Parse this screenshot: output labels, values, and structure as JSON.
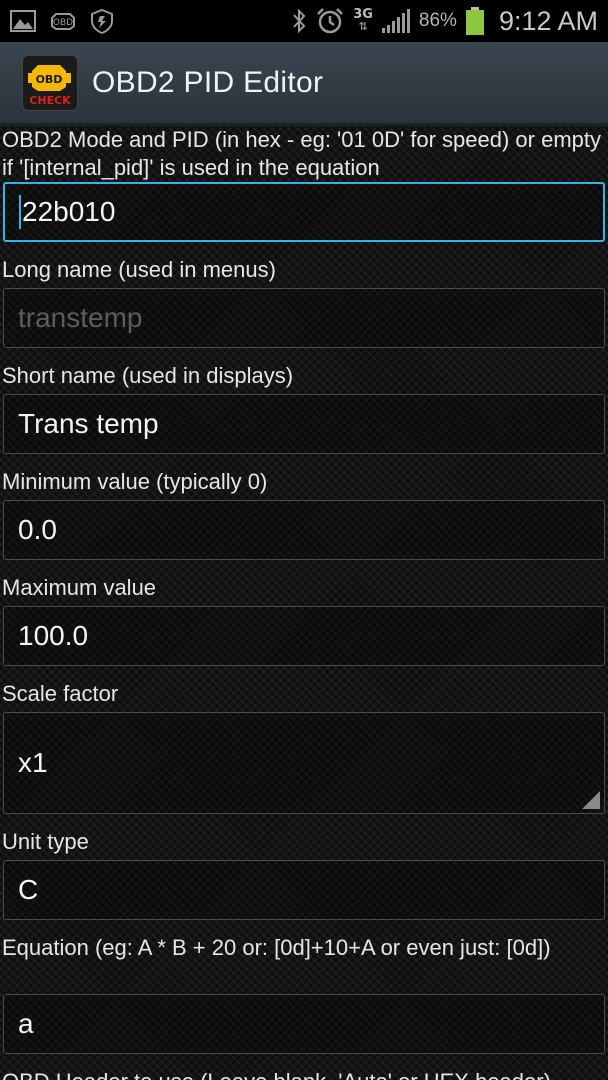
{
  "status_bar": {
    "battery_percent": "86%",
    "clock": "9:12 AM",
    "network": "3G",
    "icons": [
      "gallery-icon",
      "obd-icon",
      "shield-icon",
      "bluetooth-icon",
      "alarm-icon",
      "network-3g-icon",
      "signal-icon",
      "battery-icon"
    ]
  },
  "app_bar": {
    "title": "OBD2 PID Editor",
    "icon_text_top": "OBD",
    "icon_text_bottom": "CHECK"
  },
  "fields": {
    "mode_pid": {
      "label": "OBD2 Mode and PID (in hex - eg: '01 0D' for speed) or empty if '[internal_pid]' is used in the equation",
      "value": "22b010"
    },
    "long_name": {
      "label": "Long name (used in menus)",
      "value": "transtemp"
    },
    "short_name": {
      "label": "Short name (used in displays)",
      "value": "Trans temp"
    },
    "min_value": {
      "label": "Minimum value (typically 0)",
      "value": "0.0"
    },
    "max_value": {
      "label": "Maximum value",
      "value": "100.0"
    },
    "scale_factor": {
      "label": "Scale factor",
      "value": "x1"
    },
    "unit_type": {
      "label": "Unit type",
      "value": "C"
    },
    "equation": {
      "label": "Equation (eg:  A * B + 20   or: [0d]+10+A  or even just: [0d])",
      "value": "a"
    },
    "obd_header": {
      "label": "OBD Header to use (Leave blank, 'Auto' or HEX header)"
    }
  },
  "colors": {
    "accent": "#33b5e5",
    "battery": "#8cc63f",
    "icon_warning": "#f5b800",
    "icon_check": "#e02020"
  }
}
